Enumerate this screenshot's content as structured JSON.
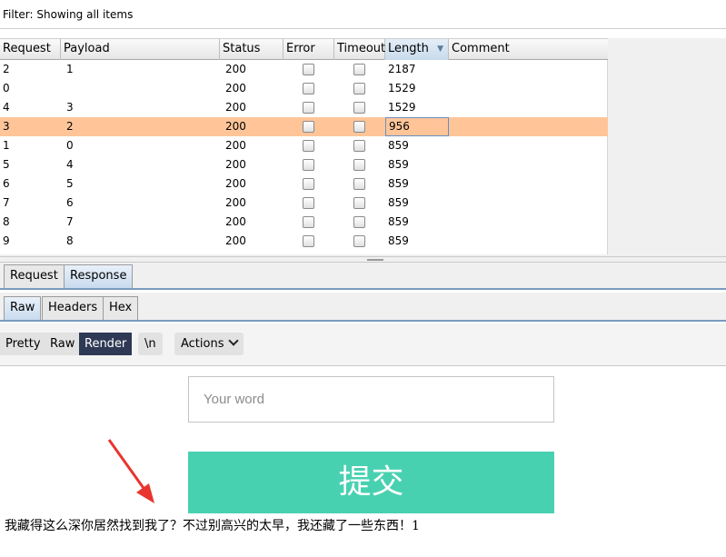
{
  "filter": {
    "text": "Filter: Showing all items"
  },
  "table": {
    "columns": [
      "Request",
      "Payload",
      "Status",
      "Error",
      "Timeout",
      "Length",
      "Comment"
    ],
    "sorted_column": "Length",
    "rows": [
      {
        "request": "2",
        "payload": "1",
        "status": "200",
        "length": "2187"
      },
      {
        "request": "0",
        "payload": "",
        "status": "200",
        "length": "1529"
      },
      {
        "request": "4",
        "payload": "3",
        "status": "200",
        "length": "1529"
      },
      {
        "request": "3",
        "payload": "2",
        "status": "200",
        "length": "956"
      },
      {
        "request": "1",
        "payload": "0",
        "status": "200",
        "length": "859"
      },
      {
        "request": "5",
        "payload": "4",
        "status": "200",
        "length": "859"
      },
      {
        "request": "6",
        "payload": "5",
        "status": "200",
        "length": "859"
      },
      {
        "request": "7",
        "payload": "6",
        "status": "200",
        "length": "859"
      },
      {
        "request": "8",
        "payload": "7",
        "status": "200",
        "length": "859"
      },
      {
        "request": "9",
        "payload": "8",
        "status": "200",
        "length": "859"
      }
    ],
    "selected_row_request": "3",
    "selected_row_color": "#ffc599"
  },
  "main_tabs": [
    "Request",
    "Response"
  ],
  "main_tab_active": "Response",
  "sub_tabs": [
    "Raw",
    "Headers",
    "Hex"
  ],
  "sub_tab_active": "Raw",
  "toolbar": {
    "view_modes": [
      "Pretty",
      "Raw",
      "Render"
    ],
    "view_mode_active": "Render",
    "newline_label": "\\n",
    "actions_label": "Actions"
  },
  "render": {
    "input_placeholder": "Your word",
    "submit_label": "提交",
    "submit_color": "#48d1b1",
    "message": "我藏得这么深你居然找到我了？不过别高兴的太早，我还藏了一些东西！1",
    "arrow_color": "#e8352e"
  }
}
